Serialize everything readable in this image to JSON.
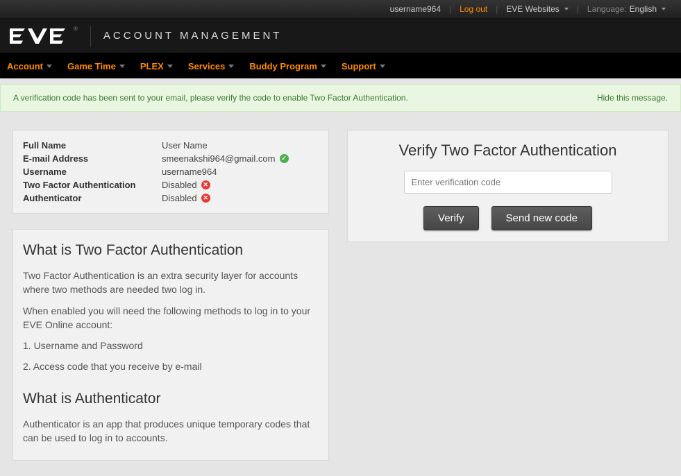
{
  "topbar": {
    "username": "username964",
    "logout": "Log out",
    "websites": "EVE Websites",
    "language_label": "Language:",
    "language_value": "English"
  },
  "header": {
    "title": "ACCOUNT MANAGEMENT"
  },
  "nav": {
    "items": [
      "Account",
      "Game Time",
      "PLEX",
      "Services",
      "Buddy Program",
      "Support"
    ]
  },
  "alert": {
    "message": "A verification code has been sent to your email, please verify the code to enable Two Factor Authentication.",
    "hide": "Hide this message."
  },
  "account": {
    "rows": [
      {
        "label": "Full Name",
        "value": "User Name",
        "status": null
      },
      {
        "label": "E-mail Address",
        "value": "smeenakshi964@gmail.com",
        "status": "ok"
      },
      {
        "label": "Username",
        "value": "username964",
        "status": null
      },
      {
        "label": "Two Factor Authentication",
        "value": "Disabled",
        "status": "bad"
      },
      {
        "label": "Authenticator",
        "value": "Disabled",
        "status": "bad"
      }
    ]
  },
  "info": {
    "tfa_heading": "What is Two Factor Authentication",
    "tfa_p1": "Two Factor Authentication is an extra security layer for accounts where two methods are needed two log in.",
    "tfa_p2": "When enabled you will need the following methods to log in to your EVE Online account:",
    "tfa_m1": "1. Username and Password",
    "tfa_m2": "2. Access code that you receive by e-mail",
    "auth_heading": "What is Authenticator",
    "auth_p1": "Authenticator is an app that produces unique temporary codes that can be used to log in to accounts."
  },
  "verify": {
    "heading": "Verify Two Factor Authentication",
    "placeholder": "Enter verification code",
    "verify_btn": "Verify",
    "send_btn": "Send new code"
  }
}
